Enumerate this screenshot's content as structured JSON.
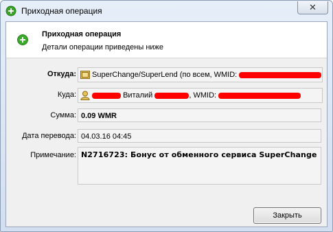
{
  "window": {
    "title": "Приходная операция"
  },
  "header": {
    "title": "Приходная операция",
    "subtitle": "Детали операции приведены ниже"
  },
  "fields": {
    "from": {
      "label": "Откуда:",
      "value": "SuperChange/SuperLend (по всем, WMID:",
      "icon": "wallet-icon"
    },
    "to": {
      "label": "Куда:",
      "value_name": "Виталий",
      "value_wmid": ", WMID:",
      "icon": "user-icon"
    },
    "amount": {
      "label": "Сумма:",
      "value": "0.09 WMR"
    },
    "date": {
      "label": "Дата перевода:",
      "value": "04.03.16 04:45"
    },
    "note": {
      "label": "Примечание:",
      "value": "N2716723: Бонус от обменного сервиса SuperChange"
    }
  },
  "buttons": {
    "close": "Закрыть",
    "window_close": "✕"
  },
  "colors": {
    "redaction": "#ff0000",
    "accent_green": "#2e9a1e"
  }
}
